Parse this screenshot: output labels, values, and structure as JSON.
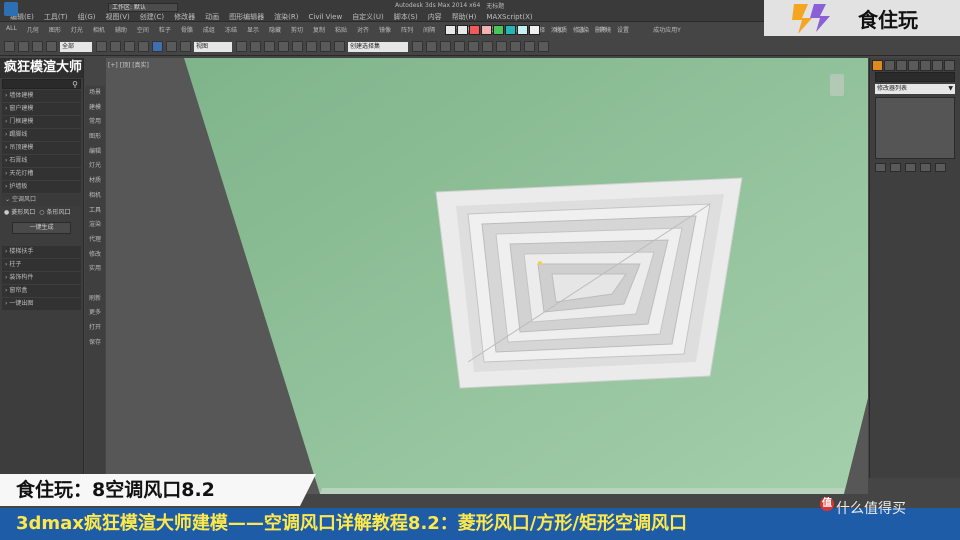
{
  "menu": {
    "items": [
      "编辑(E)",
      "工具(T)",
      "组(G)",
      "视图(V)",
      "创建(C)",
      "修改器",
      "动画",
      "图形编辑器",
      "渲染(R)",
      "Civil View",
      "自定义(U)",
      "脚本(S)",
      "内容",
      "帮助(H)",
      "MAXScript(X)"
    ],
    "workspace": "工作区: 默认",
    "app_title": "Autodesk 3ds Max 2014 x64",
    "file_title": "无标题"
  },
  "toolbar1": {
    "items": [
      "ALL",
      "几何",
      "图形",
      "灯光",
      "相机",
      "辅助",
      "空间",
      "粒子",
      "骨骼",
      "成组",
      "冻结",
      "显示",
      "隐藏",
      "剪切",
      "复制",
      "粘贴",
      "对齐",
      "镜像",
      "阵列",
      "间隔",
      "捕捉",
      "移动",
      "旋转",
      "缩放",
      "选择",
      "材质",
      "渲染",
      "环境"
    ],
    "colors": [
      "#e8e8e8",
      "#e8e8e8",
      "#f25a5a",
      "#f0b2b2",
      "#4cc45c",
      "#27b6b8",
      "#c7f0f0",
      "#f0f0f0"
    ],
    "right_labels": [
      "添加",
      "修改",
      "删除",
      "设置"
    ],
    "status": "成功应用Y"
  },
  "toolbar2": {
    "coord_system": "视图",
    "view_mode": "全部",
    "selection_set": "创建选择集"
  },
  "left_panel": {
    "title": "疯狂模渲大师",
    "items": [
      "墙体建模",
      "窗户建模",
      "门框建模",
      "踢脚线",
      "吊顶建模",
      "石膏线",
      "天花灯槽",
      "护墙板"
    ],
    "section_label": "空调风口",
    "radio_a": "菱形风口",
    "radio_b": "条形风口",
    "button_create": "一键生成",
    "items2": [
      "楼梯扶手",
      "柱子",
      "装饰构件",
      "窗帘盒",
      "一键出图"
    ]
  },
  "tab_column": [
    "场景",
    "建模",
    "常用",
    "图形",
    "编辑",
    "灯光",
    "材质",
    "相机",
    "工具",
    "渲染",
    "代理",
    "修改",
    "实用",
    "",
    "刷新",
    "更多",
    "打开",
    "保存"
  ],
  "viewport": {
    "label": "[+] [顶] [真实]",
    "wall_color": "#8fc39a",
    "diffuser_color": "#e3e3e3"
  },
  "right_panel": {
    "dropdown": "修改器列表"
  },
  "banner_top": "食住玩：8空调风口8.2",
  "banner_bottom": "3dmax疯狂模渲大师建模——空调风口详解教程8.2：菱形风口/方形/矩形空调风口",
  "logo_text": "食住玩",
  "watermark": "什么值得买"
}
